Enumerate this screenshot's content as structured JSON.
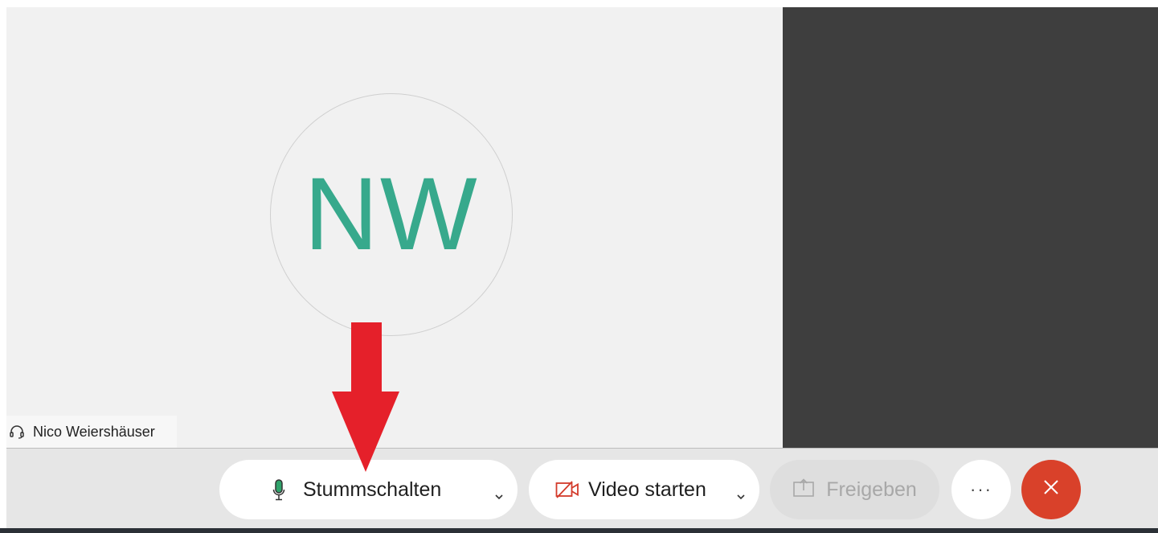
{
  "participant": {
    "initials": "NW",
    "name": "Nico Weiershäuser"
  },
  "toolbar": {
    "mute_label": "Stummschalten",
    "video_label": "Video starten",
    "share_label": "Freigeben",
    "more_label": "···"
  },
  "colors": {
    "avatar_text": "#37a98c",
    "leave_button": "#d9412a",
    "mic_icon": "#2fa36b",
    "video_icon": "#d33b2b",
    "annotation_arrow": "#e5202a",
    "side_video_bg": "#3e3e3e"
  },
  "icons": {
    "name_tag": "headset-icon",
    "mute": "microphone-icon",
    "video": "video-off-icon",
    "share": "share-screen-icon",
    "more": "more-icon",
    "leave": "close-icon"
  }
}
